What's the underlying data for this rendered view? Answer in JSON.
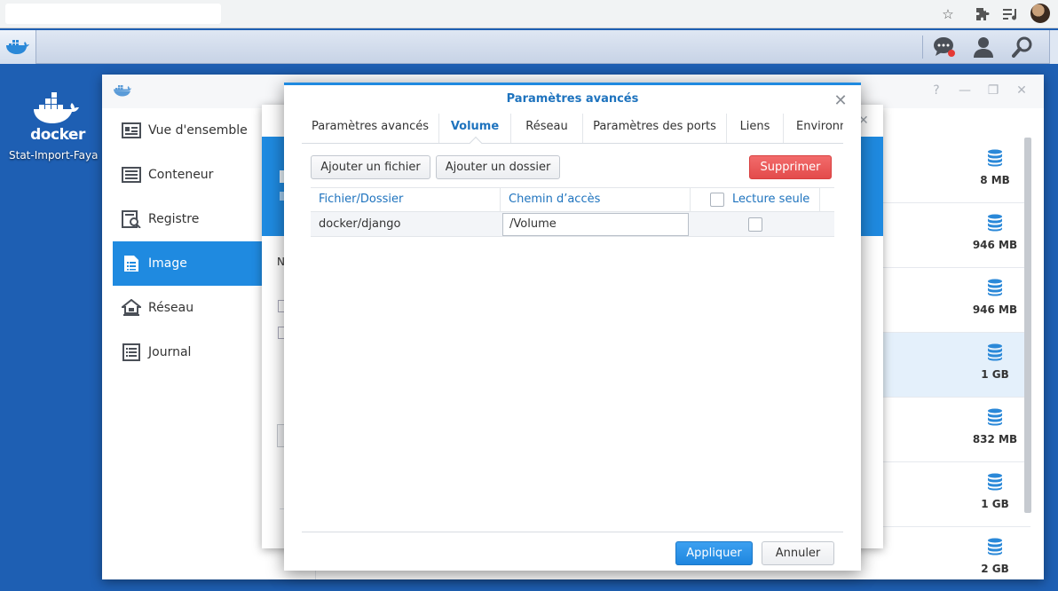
{
  "browser": {
    "icons": [
      "star-icon",
      "extensions-icon",
      "media-icon",
      "profile-avatar"
    ]
  },
  "taskbar": {
    "icons": [
      "docker-icon",
      "chat-icon",
      "user-icon",
      "search-icon"
    ]
  },
  "desktop": {
    "icon_word": "docker",
    "icon_label": "Stat-Import-Faya"
  },
  "sidebar": {
    "items": [
      {
        "label": "Vue d'ensemble",
        "icon": "overview-icon"
      },
      {
        "label": "Conteneur",
        "icon": "container-icon"
      },
      {
        "label": "Registre",
        "icon": "registry-icon"
      },
      {
        "label": "Image",
        "icon": "image-icon",
        "active": true
      },
      {
        "label": "Réseau",
        "icon": "network-icon"
      },
      {
        "label": "Journal",
        "icon": "log-icon"
      }
    ]
  },
  "images": {
    "sizes": [
      "8 MB",
      "946 MB",
      "946 MB",
      "1 GB",
      "832 MB",
      "1 GB",
      "2 GB"
    ]
  },
  "mid_window": {
    "fragment_n": "N"
  },
  "dialog": {
    "title": "Paramètres avancés",
    "tabs": [
      "Paramètres avancés",
      "Volume",
      "Réseau",
      "Paramètres des ports",
      "Liens",
      "Environn"
    ],
    "active_tab": "Volume",
    "add_file": "Ajouter un fichier",
    "add_folder": "Ajouter un dossier",
    "delete": "Supprimer",
    "columns": {
      "file_folder": "Fichier/Dossier",
      "path": "Chemin d’accès",
      "read_only": "Lecture seule"
    },
    "rows": [
      {
        "file_folder": "docker/django",
        "path": "/Volume",
        "read_only": false
      }
    ],
    "apply": "Appliquer",
    "cancel": "Annuler"
  },
  "colors": {
    "accent": "#1f8ae0",
    "danger": "#e34b4b",
    "desktop": "#1e5fb3"
  }
}
